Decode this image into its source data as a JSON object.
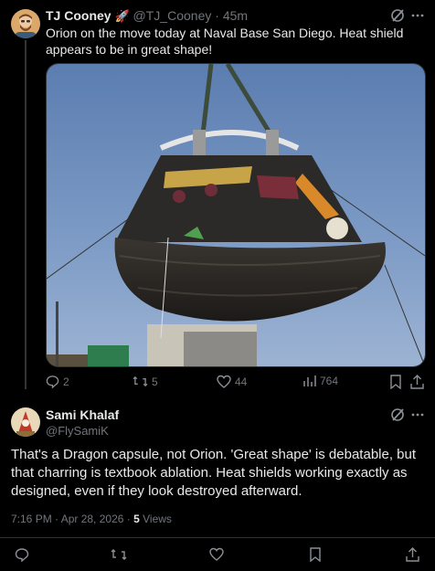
{
  "tweet": {
    "author_name": "TJ Cooney",
    "author_emoji": "🚀",
    "handle": "@TJ_Cooney",
    "separator": "·",
    "time": "45m",
    "text": "Orion on the move today at Naval Base San Diego. Heat shield appears to be in great shape!",
    "actions": {
      "replies": "2",
      "reposts": "5",
      "likes": "44",
      "views": "764"
    }
  },
  "reply": {
    "author_name": "Sami Khalaf",
    "handle": "@FlySamiK",
    "text": "That's a Dragon capsule, not Orion. 'Great shape' is debatable, but that charring is textbook ablation. Heat shields working exactly as designed, even if they look destroyed afterward.",
    "meta_time": "7:16 PM · Apr 28, 2026 ·",
    "views_count": "5",
    "views_label": "Views"
  },
  "icons": {
    "more": "more-icon",
    "grok": "grok-icon",
    "reply": "reply-icon",
    "repost": "repost-icon",
    "like": "like-icon",
    "views": "views-icon",
    "bookmark": "bookmark-icon",
    "share": "share-icon"
  },
  "colors": {
    "background": "#000000",
    "text": "#e7e9ea",
    "muted": "#71767b",
    "sky": "#6f8fb8"
  }
}
